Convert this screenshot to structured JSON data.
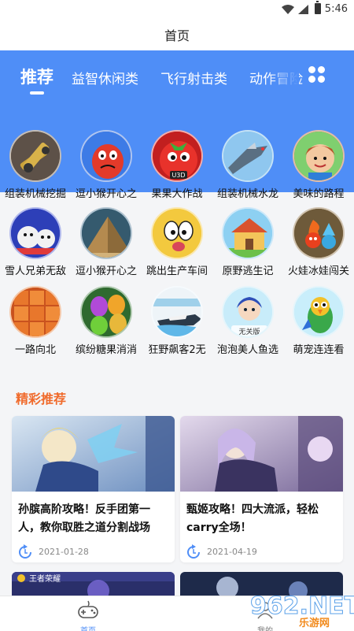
{
  "status": {
    "time": "5:46"
  },
  "header": {
    "title": "首页"
  },
  "tabs": [
    {
      "label": "推荐",
      "active": true
    },
    {
      "label": "益智休闲类",
      "active": false
    },
    {
      "label": "飞行射击类",
      "active": false
    },
    {
      "label": "动作冒险",
      "active": false
    }
  ],
  "games": [
    {
      "name": "组装机械挖掘",
      "icon": "robot-excavator-icon"
    },
    {
      "name": "逗小猴开心之",
      "icon": "red-monster-icon"
    },
    {
      "name": "果果大作战",
      "icon": "tomato-icon"
    },
    {
      "name": "组装机械水龙",
      "icon": "robot-dragon-icon"
    },
    {
      "name": "美味的路程",
      "icon": "boy-icon"
    },
    {
      "name": "雪人兄弟无敌",
      "icon": "snowman-icon"
    },
    {
      "name": "逗小猴开心之",
      "icon": "pyramid-icon"
    },
    {
      "name": "跳出生产车间",
      "icon": "cartoon-face-icon"
    },
    {
      "name": "原野逃生记",
      "icon": "house-icon"
    },
    {
      "name": "火娃冰娃闯关",
      "icon": "fire-ice-icon"
    },
    {
      "name": "一路向北",
      "icon": "blocks-icon"
    },
    {
      "name": "缤纷糖果消消",
      "icon": "candy-icon"
    },
    {
      "name": "狂野飙客2无",
      "icon": "racing-boat-icon"
    },
    {
      "name": "泡泡美人鱼选",
      "icon": "mermaid-icon"
    },
    {
      "name": "萌宠连连看",
      "icon": "parrot-icon"
    }
  ],
  "game_badges": {
    "tomato": "U3D",
    "mermaid": "无关版"
  },
  "section": {
    "title": "精彩推荐"
  },
  "cards": [
    {
      "title": "孙膑高阶攻略！反手团第一人，教你取胜之道分割战场",
      "date": "2021-01-28"
    },
    {
      "title": "甄姬攻略！四大流派，轻松carry全场！",
      "date": "2021-04-19"
    }
  ],
  "partial_cards": [
    {
      "caption": "王者荣耀"
    }
  ],
  "bottom_nav": [
    {
      "label": "首页",
      "active": true
    },
    {
      "label": "我的",
      "active": false
    }
  ],
  "watermark": {
    "big": "962.NET",
    "small": "乐游网"
  },
  "colors": {
    "accent": "#4f8ef7",
    "section_title": "#f06a2b"
  }
}
